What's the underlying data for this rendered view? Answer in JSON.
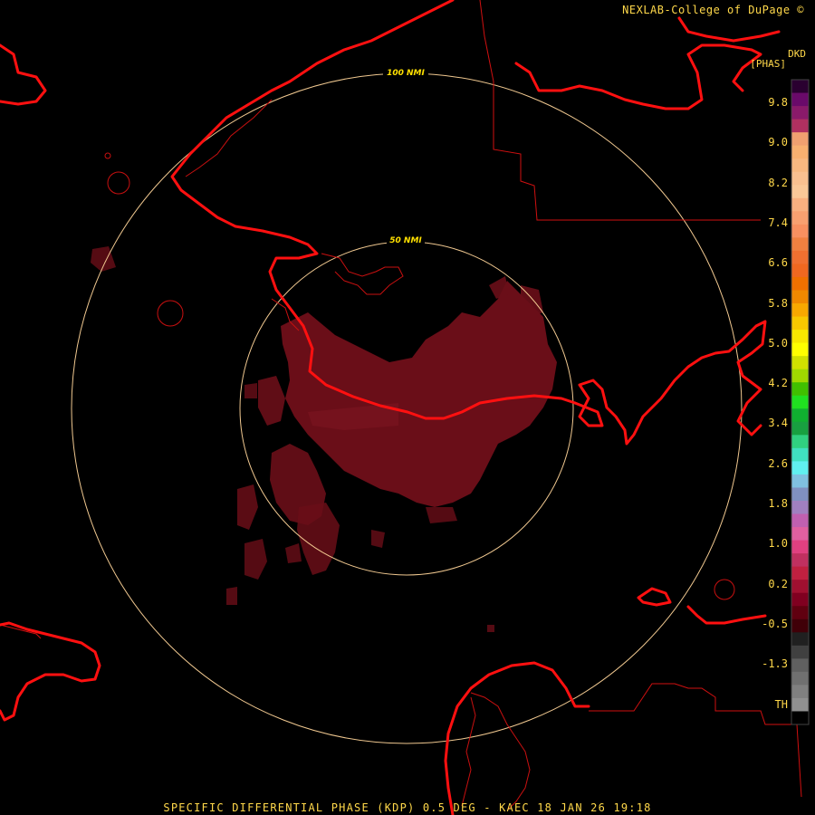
{
  "header": {
    "credit": "NEXLAB-College of DuPage ©"
  },
  "legend": {
    "product_code": "DKD",
    "unit": "[PHAS]",
    "labels": [
      "9.8",
      "9.0",
      "8.2",
      "7.4",
      "6.6",
      "5.8",
      "5.0",
      "4.2",
      "3.4",
      "2.6",
      "1.8",
      "1.0",
      "0.2",
      "-0.5",
      "-1.3",
      "TH"
    ],
    "colors": [
      "#2a0030",
      "#6a0a6a",
      "#8a1a6a",
      "#b03060",
      "#f0a070",
      "#f8b070",
      "#f8b880",
      "#f9c090",
      "#fac898",
      "#f9b080",
      "#f8a070",
      "#f89060",
      "#f08040",
      "#f07030",
      "#f06820",
      "#f07000",
      "#f08800",
      "#f8a800",
      "#f8c800",
      "#f8e800",
      "#ffff00",
      "#d0e000",
      "#a0d800",
      "#40c000",
      "#20e020",
      "#10b030",
      "#18a040",
      "#30d080",
      "#40e0c0",
      "#60f0f0",
      "#80c0e0",
      "#8090c0",
      "#a080c0",
      "#c060b0",
      "#e060a0",
      "#e04080",
      "#c03060",
      "#c02040",
      "#a01030",
      "#800020",
      "#600010",
      "#400008",
      "#202020",
      "#404040",
      "#606060",
      "#707070",
      "#808080",
      "#909090",
      "#000000"
    ]
  },
  "rings": {
    "inner_label": "50 NMI",
    "outer_label": "100 NMI"
  },
  "footer": {
    "caption": "SPECIFIC DIFFERENTIAL PHASE (KDP) 0.5 DEG - KAEC 18 JAN 26 19:18"
  },
  "colors": {
    "background": "#000000",
    "coastline": "#ff1010",
    "border": "#d01010",
    "ring": "#f0c890",
    "echo": "#6a0e18",
    "text": "#ffd84a"
  }
}
